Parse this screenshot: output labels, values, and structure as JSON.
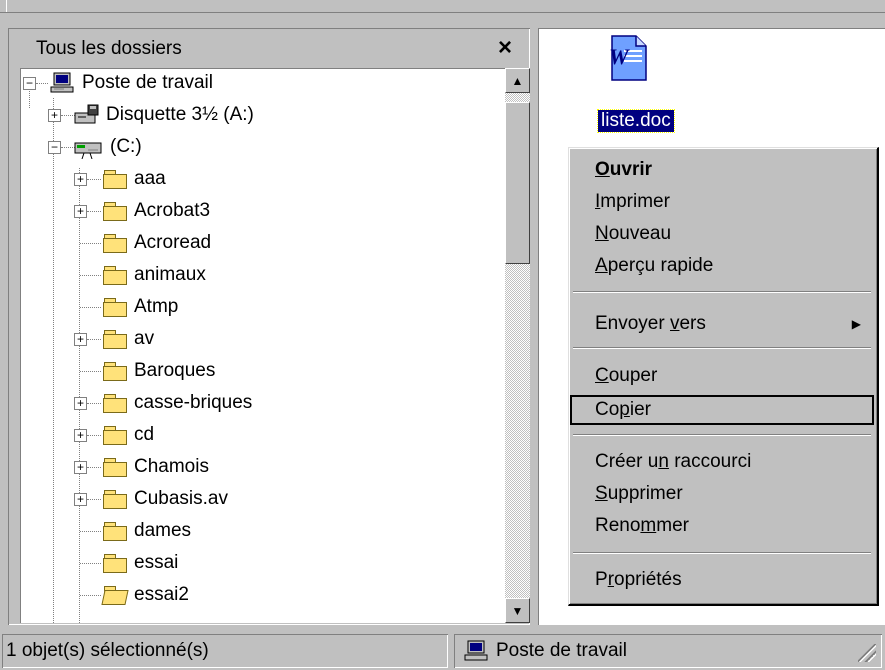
{
  "folders_panel": {
    "title": "Tous les dossiers",
    "close_glyph": "×"
  },
  "tree": {
    "root": "Poste de travail",
    "drive_a": "Disquette 3½ (A:)",
    "drive_c": "(C:)",
    "folders": [
      {
        "label": "aaa",
        "expandable": true
      },
      {
        "label": "Acrobat3",
        "expandable": true
      },
      {
        "label": "Acroread",
        "expandable": false
      },
      {
        "label": "animaux",
        "expandable": false
      },
      {
        "label": "Atmp",
        "expandable": false
      },
      {
        "label": "av",
        "expandable": true
      },
      {
        "label": "Baroques",
        "expandable": false
      },
      {
        "label": "casse-briques",
        "expandable": true
      },
      {
        "label": "cd",
        "expandable": true
      },
      {
        "label": "Chamois",
        "expandable": true
      },
      {
        "label": "Cubasis.av",
        "expandable": true
      },
      {
        "label": "dames",
        "expandable": false
      },
      {
        "label": "essai",
        "expandable": false
      },
      {
        "label": "essai2",
        "expandable": false
      }
    ]
  },
  "file": {
    "name": "liste.doc",
    "icon": "word-document-icon"
  },
  "context_menu": {
    "ouvrir": "Ouvrir",
    "imprimer": "Imprimer",
    "nouveau": "Nouveau",
    "apercu": "Aperçu rapide",
    "envoyer": "Envoyer vers",
    "couper": "Couper",
    "copier": "Copier",
    "raccourci": "Créer un raccourci",
    "supprimer": "Supprimer",
    "renommer": "Renommer",
    "proprietes": "Propriétés"
  },
  "status_bar": {
    "selection": "1 objet(s) sélectionné(s)",
    "location": "Poste de travail"
  },
  "colors": {
    "chrome": "#c0c0c0",
    "selection": "#000080",
    "folder": "#ffe27a"
  }
}
